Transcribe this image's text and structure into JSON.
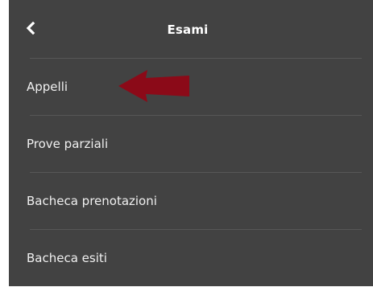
{
  "header": {
    "title": "Esami",
    "back_icon": "chevron-left-icon"
  },
  "menu": {
    "items": [
      {
        "label": "Appelli"
      },
      {
        "label": "Prove parziali"
      },
      {
        "label": "Bacheca prenotazioni"
      },
      {
        "label": "Bacheca esiti"
      }
    ]
  },
  "annotation": {
    "arrow_color": "#8b0a18",
    "arrow_icon": "left-arrow-annotation"
  },
  "colors": {
    "panel_background": "#424242",
    "divider": "#575757",
    "text": "#f0f0f0"
  }
}
